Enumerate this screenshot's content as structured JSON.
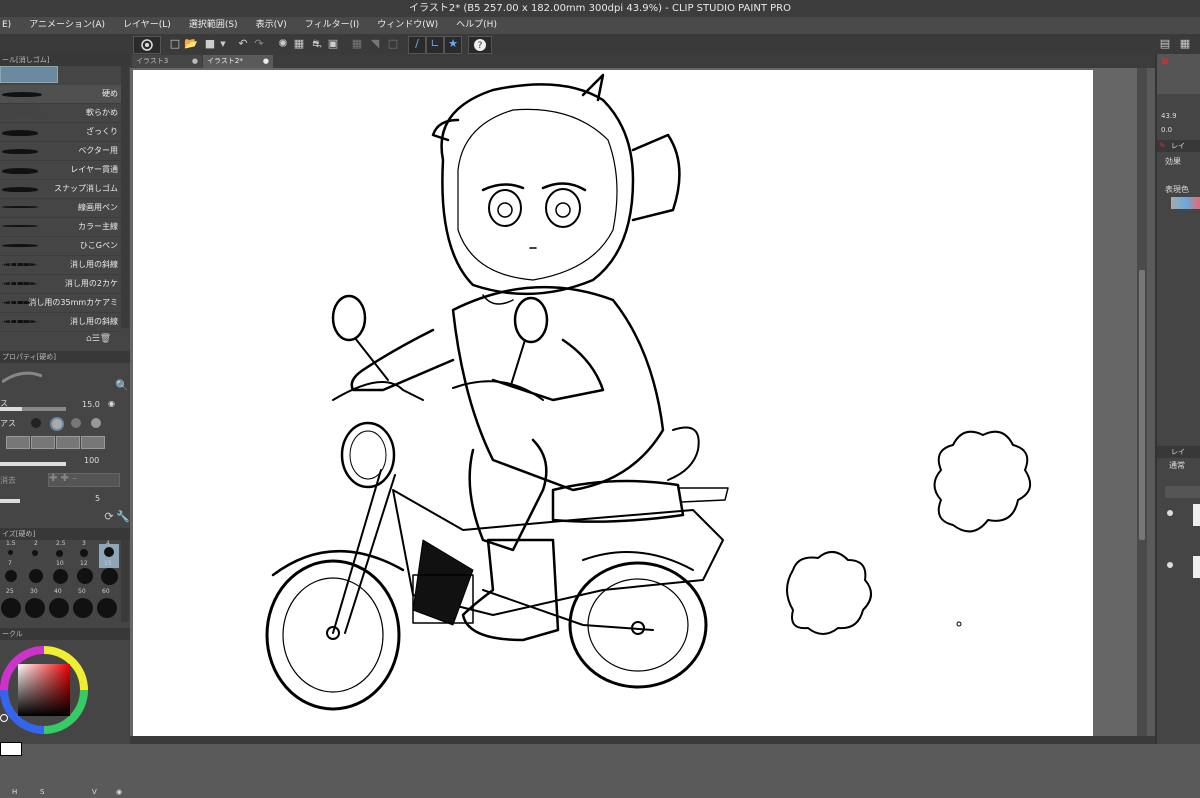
{
  "window": {
    "title": "イラスト2* (B5 257.00 x 182.00mm 300dpi 43.9%)  - CLIP STUDIO PAINT PRO"
  },
  "menu": [
    "E)",
    "アニメーション(A)",
    "レイヤー(L)",
    "選択範囲(S)",
    "表示(V)",
    "フィルター(I)",
    "ウィンドウ(W)",
    "ヘルプ(H)"
  ],
  "tabs": [
    {
      "label": "イラスト3",
      "active": false
    },
    {
      "label": "イラスト2*",
      "active": true
    }
  ],
  "sub_tool_panel": {
    "title": "ール[消しゴム]",
    "brushes": [
      "硬め",
      "軟らかめ",
      "ざっくり",
      "ベクター用",
      "レイヤー貫通",
      "スナップ消しゴム",
      "線画用ペン",
      "カラー主線",
      "ひこGペン",
      "消し用の斜線",
      "消し用の2カケ",
      "消し用の35mmカケアミ",
      "消し用の斜線"
    ]
  },
  "tool_property": {
    "title": "プロパティ[硬め]",
    "size_label": "ス",
    "size_value": "15.0",
    "aa_label": "アス",
    "opacity_value": "100",
    "erase_label": "消去",
    "density_value": "5"
  },
  "brush_size_panel": {
    "title": "イズ[硬め]",
    "row0": [
      "1.5",
      "2",
      "2.5",
      "3",
      "4"
    ],
    "row1": [
      "7",
      "10",
      "12",
      "15"
    ],
    "row2": [
      "25",
      "30",
      "40",
      "50",
      "60"
    ]
  },
  "color_panel": {
    "title": "ークル",
    "ring_labels": [
      "H",
      "S",
      "V"
    ]
  },
  "right_panel": {
    "nav_values": [
      "43.9",
      "0.0"
    ],
    "effect_label": "効果",
    "display_color_label": "表現色",
    "layer_tab": "レイ",
    "layer_panel_tab": "レイ",
    "blend_mode": "通常"
  },
  "colors": {
    "chrome_dark": "#3a3a3a",
    "panel": "#454545",
    "selected_brush": "#6b8aa0",
    "size_selected": "#8fa5b8"
  }
}
